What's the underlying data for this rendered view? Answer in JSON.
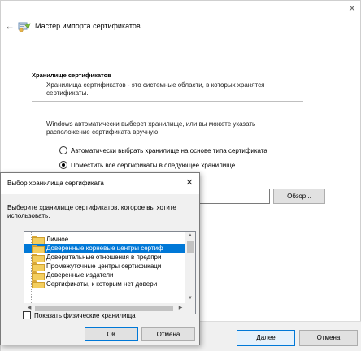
{
  "wizard": {
    "title": "Мастер импорта сертификатов",
    "section_title": "Хранилище сертификатов",
    "section_desc": "Хранилища сертификатов - это системные области, в которых хранятся сертификаты.",
    "body_text": "Windows автоматически выберет хранилище, или вы можете указать расположение сертификата вручную.",
    "radio_auto": "Автоматически выбрать хранилище на основе типа сертификата",
    "radio_manual": "Поместить все сертификаты в следующее хранилище",
    "radio_selected": "manual",
    "store_path_value": "",
    "browse_label": "Обзор...",
    "next_label": "Далее",
    "cancel_label": "Отмена",
    "close_glyph": "✕",
    "back_glyph": "←"
  },
  "dialog": {
    "title": "Выбор хранилища сертификата",
    "close_glyph": "✕",
    "prompt": "Выберите хранилище сертификатов, которое вы хотите использовать.",
    "stores": [
      {
        "label": "Личное",
        "selected": false
      },
      {
        "label": "Доверенные корневые центры сертиф",
        "selected": true
      },
      {
        "label": "Доверительные отношения в предпри",
        "selected": false
      },
      {
        "label": "Промежуточные центры сертификаци",
        "selected": false
      },
      {
        "label": "Доверенные издатели",
        "selected": false
      },
      {
        "label": "Сертификаты, к которым нет довери",
        "selected": false
      }
    ],
    "show_physical_label": "Показать физические хранилища",
    "show_physical_checked": false,
    "ok_label": "ОК",
    "cancel_label": "Отмена"
  },
  "icons": {
    "wizard_icon": "certificate-wizard-icon",
    "store_icon": "folder-icon"
  },
  "colors": {
    "accent": "#0078d7",
    "selection": "#0078d7",
    "window_bg": "#ffffff",
    "dialog_bg": "#f0f0f0"
  }
}
